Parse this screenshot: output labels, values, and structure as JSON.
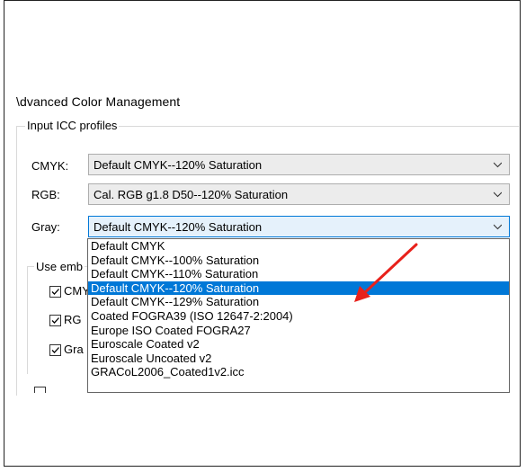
{
  "dialog_title": "\\dvanced Color Management",
  "group": {
    "label": "Input ICC profiles"
  },
  "rows": [
    {
      "label": "CMYK:",
      "value": "Default CMYK--120% Saturation"
    },
    {
      "label": "RGB:",
      "value": "Cal. RGB g1.8 D50--120% Saturation"
    },
    {
      "label": "Gray:",
      "value": "Default CMYK--120% Saturation"
    }
  ],
  "use_embedded_label": "Use emb",
  "checkboxes": [
    {
      "label": "CMY",
      "checked": true
    },
    {
      "label": "RG",
      "checked": true
    },
    {
      "label": "Gra",
      "checked": true
    }
  ],
  "dropdown": {
    "options": [
      "Default CMYK",
      "Default CMYK--100% Saturation",
      "Default CMYK--110% Saturation",
      "Default CMYK--120% Saturation",
      "Default CMYK--129% Saturation",
      "Coated FOGRA39 (ISO 12647-2:2004)",
      "Europe ISO Coated FOGRA27",
      "Euroscale Coated v2",
      "Euroscale Uncoated v2",
      "GRACoL2006_Coated1v2.icc"
    ],
    "selected_index": 3
  },
  "colors": {
    "selection": "#0078d7",
    "annotation_arrow": "#e8211b"
  }
}
